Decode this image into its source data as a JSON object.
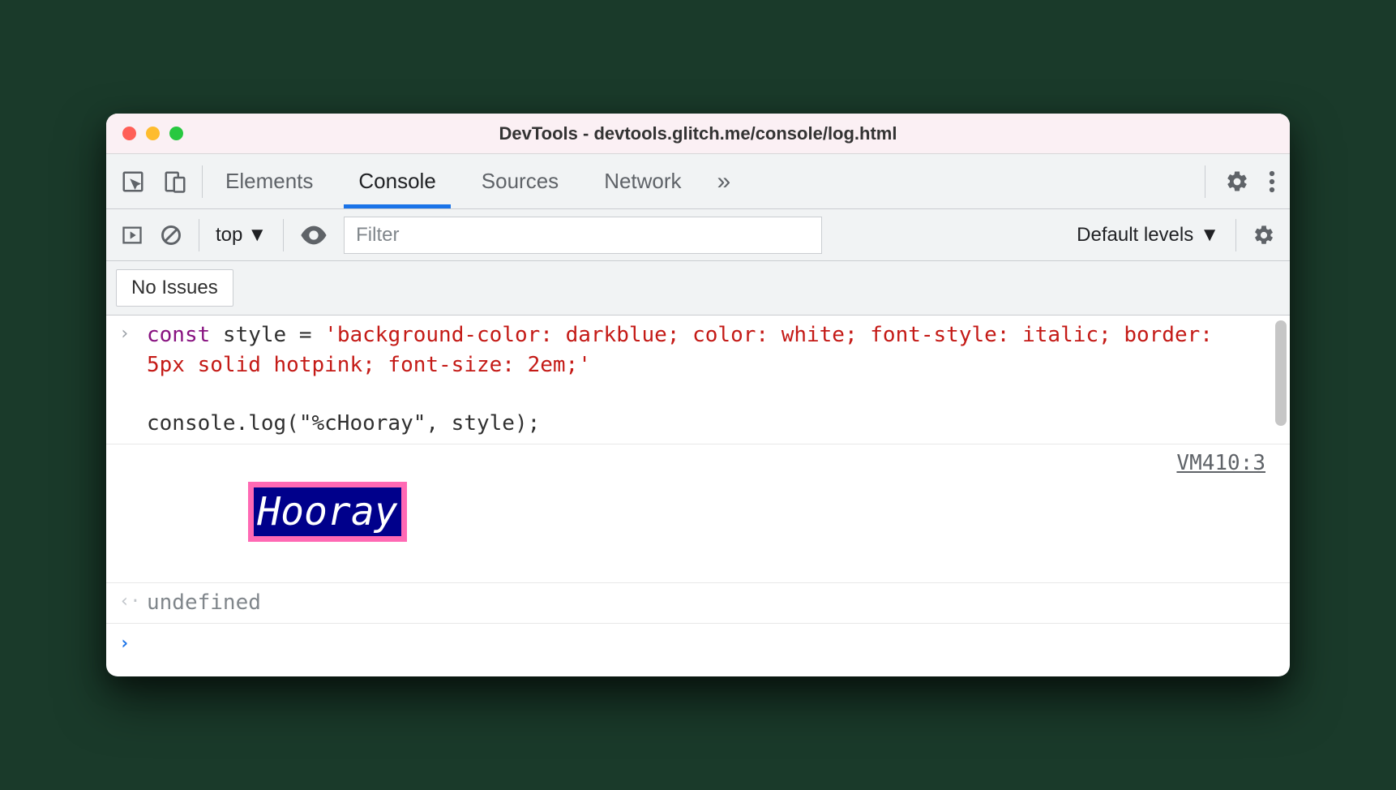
{
  "window": {
    "title": "DevTools - devtools.glitch.me/console/log.html"
  },
  "toolbar": {
    "tabs": [
      "Elements",
      "Console",
      "Sources",
      "Network"
    ],
    "active_tab": "Console"
  },
  "subbar": {
    "context": "top",
    "filter_placeholder": "Filter",
    "levels": "Default levels"
  },
  "issues": {
    "label": "No Issues"
  },
  "console": {
    "input": {
      "line1_pre": "const",
      "line1_mid": " style = ",
      "line1_str": "'background-color: darkblue; color: white; font-style: italic; border: 5px solid hotpink; font-size: 2em;'",
      "line2": "console.log(\"%cHooray\", style);"
    },
    "output": {
      "styled_text": "Hooray",
      "source_link": "VM410:3"
    },
    "return_value": "undefined"
  }
}
